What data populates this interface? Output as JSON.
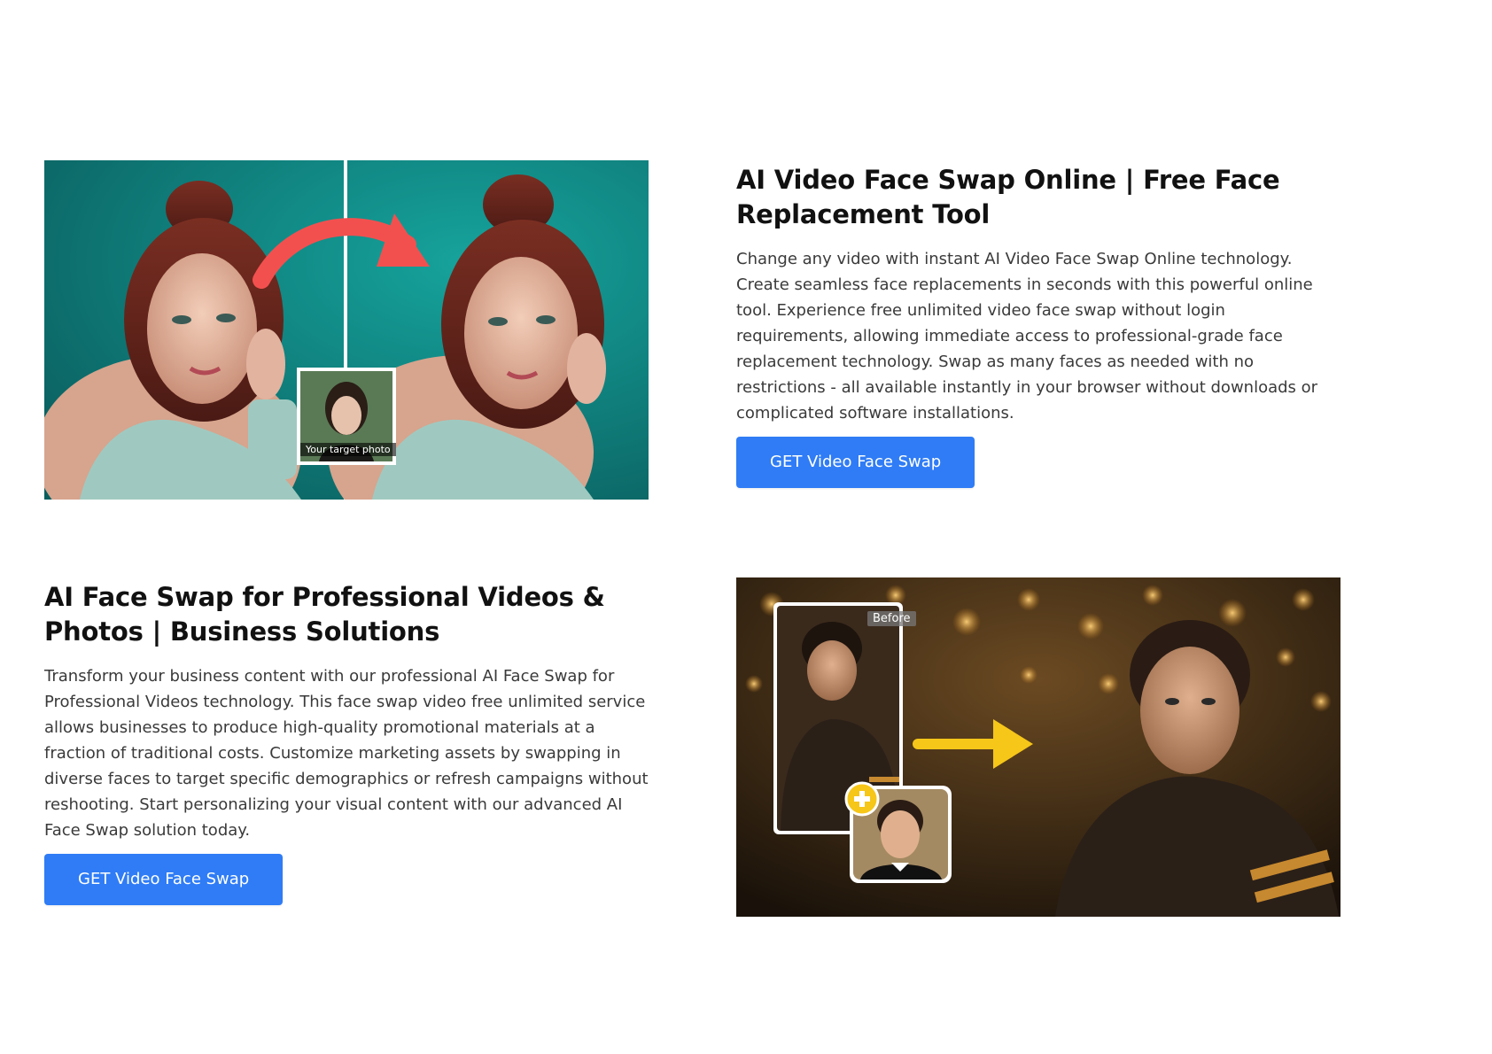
{
  "sections": [
    {
      "heading": "AI Video Face Swap Online | Free Face Replacement Tool",
      "body": "Change any video with instant AI Video Face Swap Online technology. Create seamless face replacements in seconds with this powerful online tool. Experience free unlimited video face swap without login requirements, allowing immediate access to professional-grade face replacement technology. Swap as many faces as needed with no restrictions - all available instantly in your browser without downloads or complicated software installations.",
      "button_label": "GET Video Face Swap",
      "image_caption": "Your target photo"
    },
    {
      "heading": "AI Face Swap for Professional Videos & Photos | Business Solutions",
      "body": "Transform your business content with our professional AI Face Swap for Professional Videos technology. This face swap video free unlimited service allows businesses to produce high-quality promotional materials at a fraction of traditional costs. Customize marketing assets by swapping in diverse faces to target specific demographics or refresh campaigns without reshooting. Start personalizing your visual content with our advanced AI Face Swap solution today.",
      "button_label": "GET Video Face Swap",
      "image_caption": "Before"
    }
  ],
  "colors": {
    "button_bg": "#2f7cf6",
    "teal_bg": "#0f8f8a",
    "arrow_red": "#f2504f",
    "arrow_yellow": "#f6c619"
  },
  "icons": [
    "arrow-right-icon",
    "plus-icon"
  ]
}
